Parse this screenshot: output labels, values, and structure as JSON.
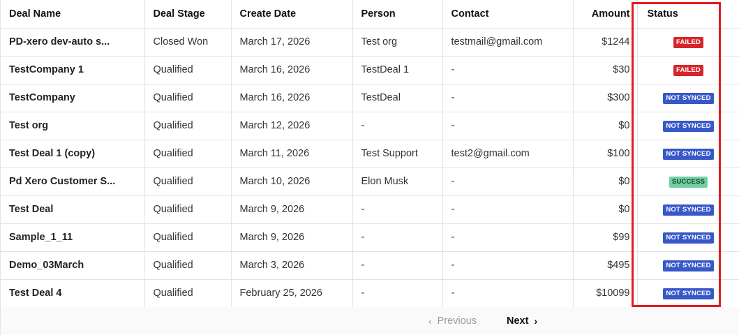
{
  "columns": [
    "Deal Name",
    "Deal Stage",
    "Create Date",
    "Person",
    "Contact",
    "Amount",
    "Status"
  ],
  "rows": [
    {
      "deal_name": "PD-xero dev-auto s...",
      "stage": "Closed Won",
      "date": "March 17, 2026",
      "person": "Test org",
      "contact": "testmail@gmail.com",
      "amount": "$1244",
      "status": "FAILED",
      "status_kind": "failed"
    },
    {
      "deal_name": "TestCompany 1",
      "stage": "Qualified",
      "date": "March 16, 2026",
      "person": "TestDeal 1",
      "contact": "-",
      "amount": "$30",
      "status": "FAILED",
      "status_kind": "failed"
    },
    {
      "deal_name": "TestCompany",
      "stage": "Qualified",
      "date": "March 16, 2026",
      "person": "TestDeal",
      "contact": "-",
      "amount": "$300",
      "status": "NOT SYNCED",
      "status_kind": "not-synced"
    },
    {
      "deal_name": "Test org",
      "stage": "Qualified",
      "date": "March 12, 2026",
      "person": "-",
      "contact": "-",
      "amount": "$0",
      "status": "NOT SYNCED",
      "status_kind": "not-synced"
    },
    {
      "deal_name": "Test Deal 1 (copy)",
      "stage": "Qualified",
      "date": "March 11, 2026",
      "person": "Test Support",
      "contact": "test2@gmail.com",
      "amount": "$100",
      "status": "NOT SYNCED",
      "status_kind": "not-synced"
    },
    {
      "deal_name": "Pd Xero Customer S...",
      "stage": "Qualified",
      "date": "March 10, 2026",
      "person": "Elon Musk",
      "contact": "-",
      "amount": "$0",
      "status": "SUCCESS",
      "status_kind": "success"
    },
    {
      "deal_name": "Test Deal",
      "stage": "Qualified",
      "date": "March 9, 2026",
      "person": "-",
      "contact": "-",
      "amount": "$0",
      "status": "NOT SYNCED",
      "status_kind": "not-synced"
    },
    {
      "deal_name": "Sample_1_11",
      "stage": "Qualified",
      "date": "March 9, 2026",
      "person": "-",
      "contact": "-",
      "amount": "$99",
      "status": "NOT SYNCED",
      "status_kind": "not-synced"
    },
    {
      "deal_name": "Demo_03March",
      "stage": "Qualified",
      "date": "March 3, 2026",
      "person": "-",
      "contact": "-",
      "amount": "$495",
      "status": "NOT SYNCED",
      "status_kind": "not-synced"
    },
    {
      "deal_name": "Test Deal 4",
      "stage": "Qualified",
      "date": "February 25, 2026",
      "person": "-",
      "contact": "-",
      "amount": "$10099",
      "status": "NOT SYNCED",
      "status_kind": "not-synced"
    }
  ],
  "pagination": {
    "previous_label": "Previous",
    "next_label": "Next",
    "previous_icon": "chevron-left-icon",
    "next_icon": "chevron-right-icon"
  },
  "colors": {
    "failed": "#d7262b",
    "not_synced": "#3758c9",
    "success": "#6fd0a3",
    "highlight": "#e01d1d"
  }
}
